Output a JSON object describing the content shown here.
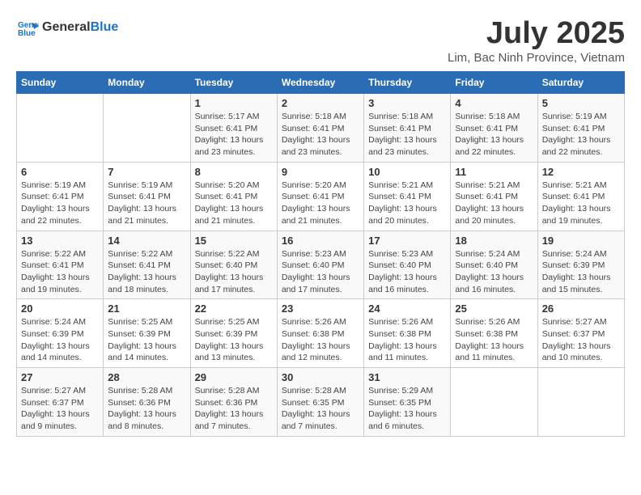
{
  "header": {
    "logo_line1": "General",
    "logo_line2": "Blue",
    "month_year": "July 2025",
    "location": "Lim, Bac Ninh Province, Vietnam"
  },
  "days_of_week": [
    "Sunday",
    "Monday",
    "Tuesday",
    "Wednesday",
    "Thursday",
    "Friday",
    "Saturday"
  ],
  "weeks": [
    [
      {
        "day": "",
        "detail": ""
      },
      {
        "day": "",
        "detail": ""
      },
      {
        "day": "1",
        "detail": "Sunrise: 5:17 AM\nSunset: 6:41 PM\nDaylight: 13 hours\nand 23 minutes."
      },
      {
        "day": "2",
        "detail": "Sunrise: 5:18 AM\nSunset: 6:41 PM\nDaylight: 13 hours\nand 23 minutes."
      },
      {
        "day": "3",
        "detail": "Sunrise: 5:18 AM\nSunset: 6:41 PM\nDaylight: 13 hours\nand 23 minutes."
      },
      {
        "day": "4",
        "detail": "Sunrise: 5:18 AM\nSunset: 6:41 PM\nDaylight: 13 hours\nand 22 minutes."
      },
      {
        "day": "5",
        "detail": "Sunrise: 5:19 AM\nSunset: 6:41 PM\nDaylight: 13 hours\nand 22 minutes."
      }
    ],
    [
      {
        "day": "6",
        "detail": "Sunrise: 5:19 AM\nSunset: 6:41 PM\nDaylight: 13 hours\nand 22 minutes."
      },
      {
        "day": "7",
        "detail": "Sunrise: 5:19 AM\nSunset: 6:41 PM\nDaylight: 13 hours\nand 21 minutes."
      },
      {
        "day": "8",
        "detail": "Sunrise: 5:20 AM\nSunset: 6:41 PM\nDaylight: 13 hours\nand 21 minutes."
      },
      {
        "day": "9",
        "detail": "Sunrise: 5:20 AM\nSunset: 6:41 PM\nDaylight: 13 hours\nand 21 minutes."
      },
      {
        "day": "10",
        "detail": "Sunrise: 5:21 AM\nSunset: 6:41 PM\nDaylight: 13 hours\nand 20 minutes."
      },
      {
        "day": "11",
        "detail": "Sunrise: 5:21 AM\nSunset: 6:41 PM\nDaylight: 13 hours\nand 20 minutes."
      },
      {
        "day": "12",
        "detail": "Sunrise: 5:21 AM\nSunset: 6:41 PM\nDaylight: 13 hours\nand 19 minutes."
      }
    ],
    [
      {
        "day": "13",
        "detail": "Sunrise: 5:22 AM\nSunset: 6:41 PM\nDaylight: 13 hours\nand 19 minutes."
      },
      {
        "day": "14",
        "detail": "Sunrise: 5:22 AM\nSunset: 6:41 PM\nDaylight: 13 hours\nand 18 minutes."
      },
      {
        "day": "15",
        "detail": "Sunrise: 5:22 AM\nSunset: 6:40 PM\nDaylight: 13 hours\nand 17 minutes."
      },
      {
        "day": "16",
        "detail": "Sunrise: 5:23 AM\nSunset: 6:40 PM\nDaylight: 13 hours\nand 17 minutes."
      },
      {
        "day": "17",
        "detail": "Sunrise: 5:23 AM\nSunset: 6:40 PM\nDaylight: 13 hours\nand 16 minutes."
      },
      {
        "day": "18",
        "detail": "Sunrise: 5:24 AM\nSunset: 6:40 PM\nDaylight: 13 hours\nand 16 minutes."
      },
      {
        "day": "19",
        "detail": "Sunrise: 5:24 AM\nSunset: 6:39 PM\nDaylight: 13 hours\nand 15 minutes."
      }
    ],
    [
      {
        "day": "20",
        "detail": "Sunrise: 5:24 AM\nSunset: 6:39 PM\nDaylight: 13 hours\nand 14 minutes."
      },
      {
        "day": "21",
        "detail": "Sunrise: 5:25 AM\nSunset: 6:39 PM\nDaylight: 13 hours\nand 14 minutes."
      },
      {
        "day": "22",
        "detail": "Sunrise: 5:25 AM\nSunset: 6:39 PM\nDaylight: 13 hours\nand 13 minutes."
      },
      {
        "day": "23",
        "detail": "Sunrise: 5:26 AM\nSunset: 6:38 PM\nDaylight: 13 hours\nand 12 minutes."
      },
      {
        "day": "24",
        "detail": "Sunrise: 5:26 AM\nSunset: 6:38 PM\nDaylight: 13 hours\nand 11 minutes."
      },
      {
        "day": "25",
        "detail": "Sunrise: 5:26 AM\nSunset: 6:38 PM\nDaylight: 13 hours\nand 11 minutes."
      },
      {
        "day": "26",
        "detail": "Sunrise: 5:27 AM\nSunset: 6:37 PM\nDaylight: 13 hours\nand 10 minutes."
      }
    ],
    [
      {
        "day": "27",
        "detail": "Sunrise: 5:27 AM\nSunset: 6:37 PM\nDaylight: 13 hours\nand 9 minutes."
      },
      {
        "day": "28",
        "detail": "Sunrise: 5:28 AM\nSunset: 6:36 PM\nDaylight: 13 hours\nand 8 minutes."
      },
      {
        "day": "29",
        "detail": "Sunrise: 5:28 AM\nSunset: 6:36 PM\nDaylight: 13 hours\nand 7 minutes."
      },
      {
        "day": "30",
        "detail": "Sunrise: 5:28 AM\nSunset: 6:35 PM\nDaylight: 13 hours\nand 7 minutes."
      },
      {
        "day": "31",
        "detail": "Sunrise: 5:29 AM\nSunset: 6:35 PM\nDaylight: 13 hours\nand 6 minutes."
      },
      {
        "day": "",
        "detail": ""
      },
      {
        "day": "",
        "detail": ""
      }
    ]
  ]
}
